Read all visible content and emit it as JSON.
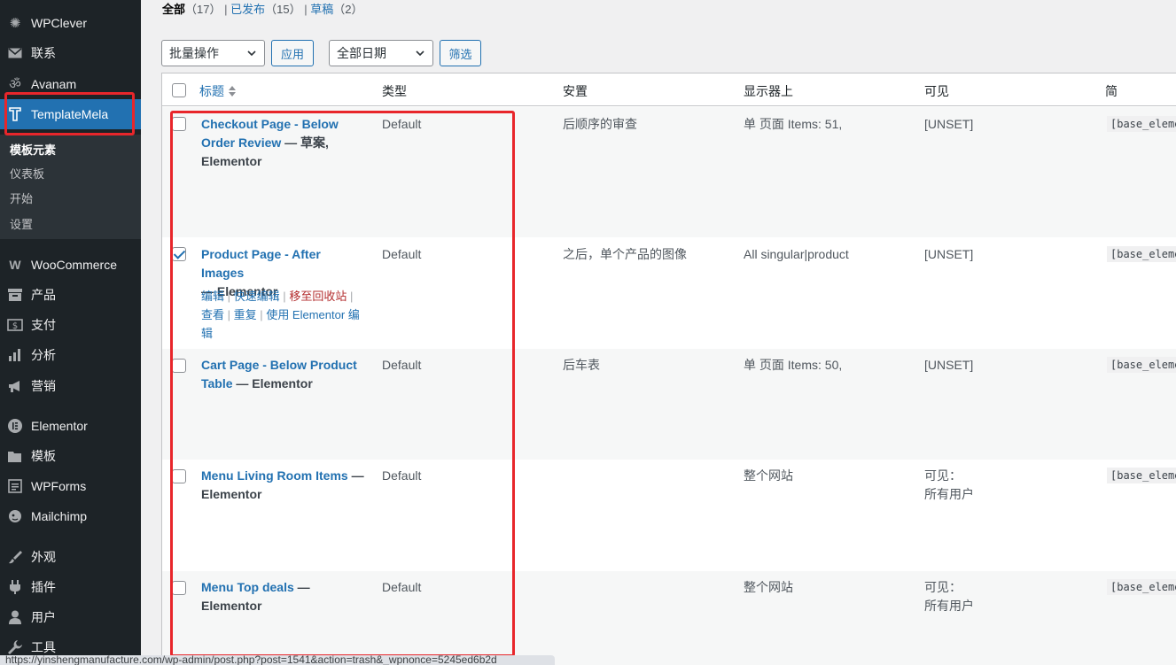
{
  "sidebar": {
    "items": [
      {
        "label": "WPClever",
        "icon": "bulb-icon"
      },
      {
        "label": "联系",
        "icon": "mail-icon"
      },
      {
        "label": "Avanam",
        "icon": "om-icon"
      },
      {
        "label": "TemplateMela",
        "icon": "templatemela-icon"
      },
      {
        "label": "WooCommerce",
        "icon": "woo-icon"
      },
      {
        "label": "产品",
        "icon": "archive-icon"
      },
      {
        "label": "支付",
        "icon": "dollar-icon"
      },
      {
        "label": "分析",
        "icon": "bar-chart-icon"
      },
      {
        "label": "营销",
        "icon": "megaphone-icon"
      },
      {
        "label": "Elementor",
        "icon": "elementor-icon"
      },
      {
        "label": "模板",
        "icon": "folder-icon"
      },
      {
        "label": "WPForms",
        "icon": "form-icon"
      },
      {
        "label": "Mailchimp",
        "icon": "mailchimp-icon"
      },
      {
        "label": "外观",
        "icon": "brush-icon"
      },
      {
        "label": "插件",
        "icon": "plug-icon"
      },
      {
        "label": "用户",
        "icon": "user-icon"
      },
      {
        "label": "工具",
        "icon": "wrench-icon"
      }
    ],
    "submenu": [
      "模板元素",
      "仪表板",
      "开始",
      "设置"
    ]
  },
  "views": {
    "all": "全部",
    "all_count": "（17）",
    "published": "已发布",
    "published_count": "（15）",
    "draft": "草稿",
    "draft_count": "（2）",
    "sep": "|"
  },
  "toolbar": {
    "bulk_select": "批量操作",
    "apply": "应用",
    "date_select": "全部日期",
    "filter": "筛选"
  },
  "table": {
    "headers": {
      "title": "标题",
      "type": "类型",
      "placement": "安置",
      "display": "显示器上",
      "visible": "可见",
      "shortcode": "简"
    },
    "rows": [
      {
        "title": "Checkout Page - Below Order Review",
        "state": " — 草案,",
        "builder": "Elementor",
        "type": "Default",
        "placement": "后顺序的审查",
        "display": "单 页面 Items: 51,",
        "visible": "[UNSET]",
        "visible2": "",
        "shortcode": "[base_element",
        "checked": false
      },
      {
        "title": "Product Page - After Images",
        "state": "",
        "builder": "— Elementor",
        "type": "Default",
        "placement": "之后，单个产品的图像",
        "display": "All singular|product",
        "visible": "[UNSET]",
        "visible2": "",
        "shortcode": "[base_element",
        "checked": true
      },
      {
        "title": "Cart Page - Below Product Table",
        "state": "",
        "builder": " — Elementor",
        "type": "Default",
        "placement": "后车表",
        "display": "单 页面 Items: 50,",
        "visible": "[UNSET]",
        "visible2": "",
        "shortcode": "[base_element",
        "checked": false
      },
      {
        "title": "Menu Living Room Items",
        "state": "",
        "builder": " — Elementor",
        "type": "Default",
        "placement": "",
        "display": "整个网站",
        "visible": "可见：",
        "visible2": "所有用户",
        "shortcode": "[base_element",
        "checked": false
      },
      {
        "title": "Menu Top deals",
        "state": "",
        "builder": " — Elementor",
        "type": "Default",
        "placement": "",
        "display": "整个网站",
        "visible": "可见：",
        "visible2": "所有用户",
        "shortcode": "[base_element",
        "checked": false
      }
    ],
    "row_actions": {
      "edit": "编辑",
      "quick_edit": "快速编辑",
      "trash": "移至回收站",
      "view": "查看",
      "duplicate": "重复",
      "elementor_edit": "使用 Elementor 编辑",
      "sep": "|"
    }
  },
  "status_url": "https://yinshengmanufacture.com/wp-admin/post.php?post=1541&action=trash&_wpnonce=5245ed6b2d",
  "colors": {
    "accent": "#2271b1",
    "highlight": "#e8262b",
    "sidebar": "#1d2327",
    "trash": "#b32d2e"
  }
}
